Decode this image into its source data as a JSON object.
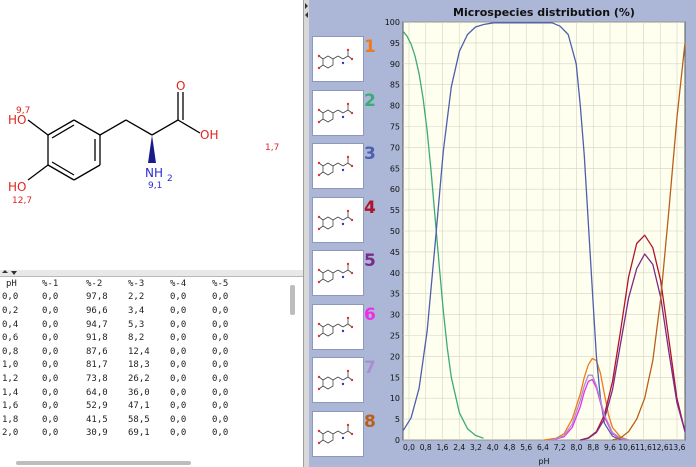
{
  "molecule": {
    "atoms": {
      "oh_top": "HO",
      "oh_bottom": "HO",
      "o_carbonyl": "O",
      "oh_acid": "OH",
      "nh2": "NH",
      "nh2_sub": "2",
      "pka_oh_top": "9,7",
      "pka_oh_bottom": "12,7",
      "pka_acid": "1,7",
      "pka_nh2": "9,1"
    },
    "colors": {
      "bond": "#000000",
      "oxygen": "#e0251e",
      "nitrogen": "#2b2bd6"
    }
  },
  "table": {
    "headers": [
      "pH",
      "%-1",
      "%-2",
      "%-3",
      "%-4",
      "%-5"
    ],
    "rows": [
      [
        "0,0",
        "0,0",
        "97,8",
        "2,2",
        "0,0",
        "0,0"
      ],
      [
        "0,2",
        "0,0",
        "96,6",
        "3,4",
        "0,0",
        "0,0"
      ],
      [
        "0,4",
        "0,0",
        "94,7",
        "5,3",
        "0,0",
        "0,0"
      ],
      [
        "0,6",
        "0,0",
        "91,8",
        "8,2",
        "0,0",
        "0,0"
      ],
      [
        "0,8",
        "0,0",
        "87,6",
        "12,4",
        "0,0",
        "0,0"
      ],
      [
        "1,0",
        "0,0",
        "81,7",
        "18,3",
        "0,0",
        "0,0"
      ],
      [
        "1,2",
        "0,0",
        "73,8",
        "26,2",
        "0,0",
        "0,0"
      ],
      [
        "1,4",
        "0,0",
        "64,0",
        "36,0",
        "0,0",
        "0,0"
      ],
      [
        "1,6",
        "0,0",
        "52,9",
        "47,1",
        "0,0",
        "0,0"
      ],
      [
        "1,8",
        "0,0",
        "41,5",
        "58,5",
        "0,0",
        "0,0"
      ],
      [
        "2,0",
        "0,0",
        "30,9",
        "69,1",
        "0,0",
        "0,0"
      ]
    ]
  },
  "species": [
    {
      "label": "1",
      "color": "#f07a1a"
    },
    {
      "label": "2",
      "color": "#3cab78"
    },
    {
      "label": "3",
      "color": "#4d5fae"
    },
    {
      "label": "4",
      "color": "#b0142c"
    },
    {
      "label": "5",
      "color": "#7b2a8a"
    },
    {
      "label": "6",
      "color": "#ee2ee6"
    },
    {
      "label": "7",
      "color": "#a690d2"
    },
    {
      "label": "8",
      "color": "#b86018"
    }
  ],
  "chart_data": {
    "type": "line",
    "title": "Microspecies distribution (%)",
    "xlabel": "pH",
    "ylabel": "",
    "xlim": [
      0,
      14
    ],
    "ylim": [
      0,
      100
    ],
    "x_ticks": [
      "0,0",
      "0,8",
      "1,6",
      "2,4",
      "3,2",
      "4,0",
      "4,8",
      "5,6",
      "6,4",
      "7,2",
      "8,0",
      "8,8",
      "9,6",
      "10,6",
      "11,6",
      "12,6",
      "13,6"
    ],
    "y_ticks": [
      0,
      5,
      10,
      15,
      20,
      25,
      30,
      35,
      40,
      45,
      50,
      55,
      60,
      65,
      70,
      75,
      80,
      85,
      90,
      95,
      100
    ],
    "grid": true,
    "background": "#fffff0",
    "series": [
      {
        "id": "s1",
        "color": "#f07a1a",
        "x": [
          7.0,
          7.6,
          8.0,
          8.4,
          8.8,
          9.0,
          9.2,
          9.4,
          9.6,
          9.8,
          10.0,
          10.2,
          10.4,
          10.8,
          11.2
        ],
        "y": [
          0,
          0.4,
          1.5,
          5,
          11,
          15,
          18,
          19.5,
          19,
          16,
          11,
          6,
          3,
          0.7,
          0
        ]
      },
      {
        "id": "s2",
        "color": "#3cab78",
        "x": [
          0,
          0.2,
          0.4,
          0.6,
          0.8,
          1.0,
          1.2,
          1.4,
          1.6,
          1.8,
          2.0,
          2.2,
          2.4,
          2.8,
          3.2,
          3.6,
          4.0
        ],
        "y": [
          97.8,
          96.6,
          94.7,
          91.8,
          87.6,
          81.7,
          73.8,
          64.0,
          52.9,
          41.5,
          30.9,
          22.0,
          15.0,
          6.5,
          2.7,
          1.1,
          0.4
        ]
      },
      {
        "id": "s3",
        "color": "#4d5fae",
        "x": [
          0,
          0.4,
          0.8,
          1.2,
          1.6,
          2.0,
          2.4,
          2.8,
          3.2,
          3.6,
          4.0,
          4.5,
          7.4,
          7.8,
          8.2,
          8.6,
          8.8,
          9.0,
          9.2,
          9.4,
          9.6,
          9.8,
          10.0,
          10.4,
          10.8
        ],
        "y": [
          2.2,
          5.3,
          12.4,
          26.2,
          47.1,
          69.1,
          84.5,
          93.0,
          97.0,
          98.8,
          99.4,
          99.8,
          99.8,
          99.0,
          97.0,
          90.0,
          80.0,
          68.0,
          52.0,
          36.0,
          20.0,
          10.0,
          4.0,
          0.9,
          0.1
        ]
      },
      {
        "id": "s4",
        "color": "#b0142c",
        "x": [
          8.8,
          9.2,
          9.6,
          10.0,
          10.4,
          10.8,
          11.2,
          11.6,
          12.0,
          12.4,
          12.8,
          13.2,
          13.6,
          14.0
        ],
        "y": [
          0,
          0.5,
          2,
          6,
          14,
          26,
          39,
          47,
          49,
          46,
          38,
          24,
          10,
          2
        ]
      },
      {
        "id": "s5",
        "color": "#7b2a8a",
        "x": [
          8.8,
          9.2,
          9.6,
          10.0,
          10.4,
          10.8,
          11.2,
          11.6,
          12.0,
          12.4,
          12.8,
          13.2,
          13.6,
          14.0
        ],
        "y": [
          0,
          0.4,
          1.8,
          5,
          12,
          23,
          34,
          41,
          44.5,
          42,
          34,
          21,
          9,
          2
        ]
      },
      {
        "id": "s6",
        "color": "#ee2ee6",
        "x": [
          7.4,
          8.0,
          8.4,
          8.8,
          9.0,
          9.2,
          9.4,
          9.6,
          9.8,
          10.0,
          10.4,
          10.8,
          11.2
        ],
        "y": [
          0,
          0.8,
          3,
          8,
          11.5,
          14,
          14.5,
          12.5,
          9,
          5.5,
          1.5,
          0.3,
          0
        ]
      },
      {
        "id": "s7",
        "color": "#a690d2",
        "x": [
          7.4,
          8.0,
          8.4,
          8.8,
          9.0,
          9.2,
          9.4,
          9.6,
          9.8,
          10.0,
          10.4,
          10.8,
          11.2
        ],
        "y": [
          0,
          1,
          3.8,
          9.5,
          13,
          15.5,
          15.5,
          13,
          9.5,
          6,
          1.8,
          0.4,
          0
        ]
      },
      {
        "id": "s8",
        "color": "#b86018",
        "x": [
          10.4,
          10.8,
          11.2,
          11.6,
          12.0,
          12.4,
          12.8,
          13.2,
          13.6,
          14.0
        ],
        "y": [
          0,
          0.5,
          2,
          5,
          10,
          19,
          34,
          55,
          77,
          95
        ]
      }
    ]
  }
}
